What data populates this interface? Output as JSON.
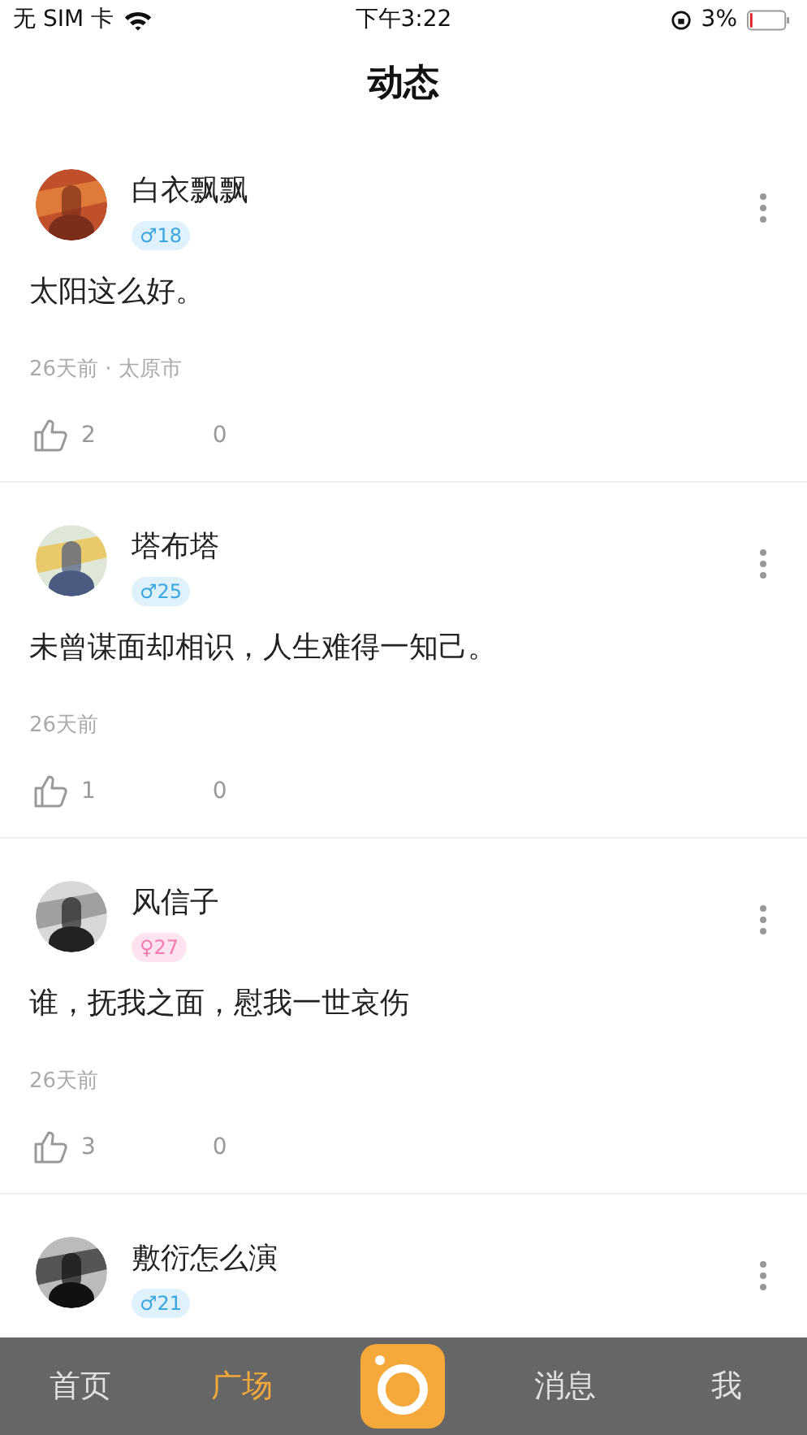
{
  "status_bar": {
    "carrier": "无 SIM 卡",
    "time": "下午3:22",
    "battery": "3%"
  },
  "title": "动态",
  "posts": [
    {
      "name": "白衣飘飘",
      "female": false,
      "badge": "♂18",
      "content": "太阳这么好。",
      "meta": "26天前 · 太原市",
      "likes": "2",
      "comments": "0"
    },
    {
      "name": "塔布塔",
      "female": false,
      "badge": "♂25",
      "content": "未曾谋面却相识，人生难得一知己。",
      "meta": "26天前",
      "likes": "1",
      "comments": "0"
    },
    {
      "name": "风信子",
      "female": true,
      "badge": "♀27",
      "content": "谁，抚我之面，慰我一世哀伤",
      "meta": "26天前",
      "likes": "3",
      "comments": "0"
    },
    {
      "name": "敷衍怎么演",
      "female": false,
      "badge": "♂21"
    }
  ],
  "tabs": [
    {
      "kind": "text",
      "label": "首页",
      "selected": false
    },
    {
      "kind": "text",
      "label": "广场",
      "selected": true
    },
    {
      "kind": "camera",
      "selected": false
    },
    {
      "kind": "text",
      "label": "消息",
      "selected": false
    },
    {
      "kind": "text",
      "label": "我",
      "selected": false
    }
  ]
}
